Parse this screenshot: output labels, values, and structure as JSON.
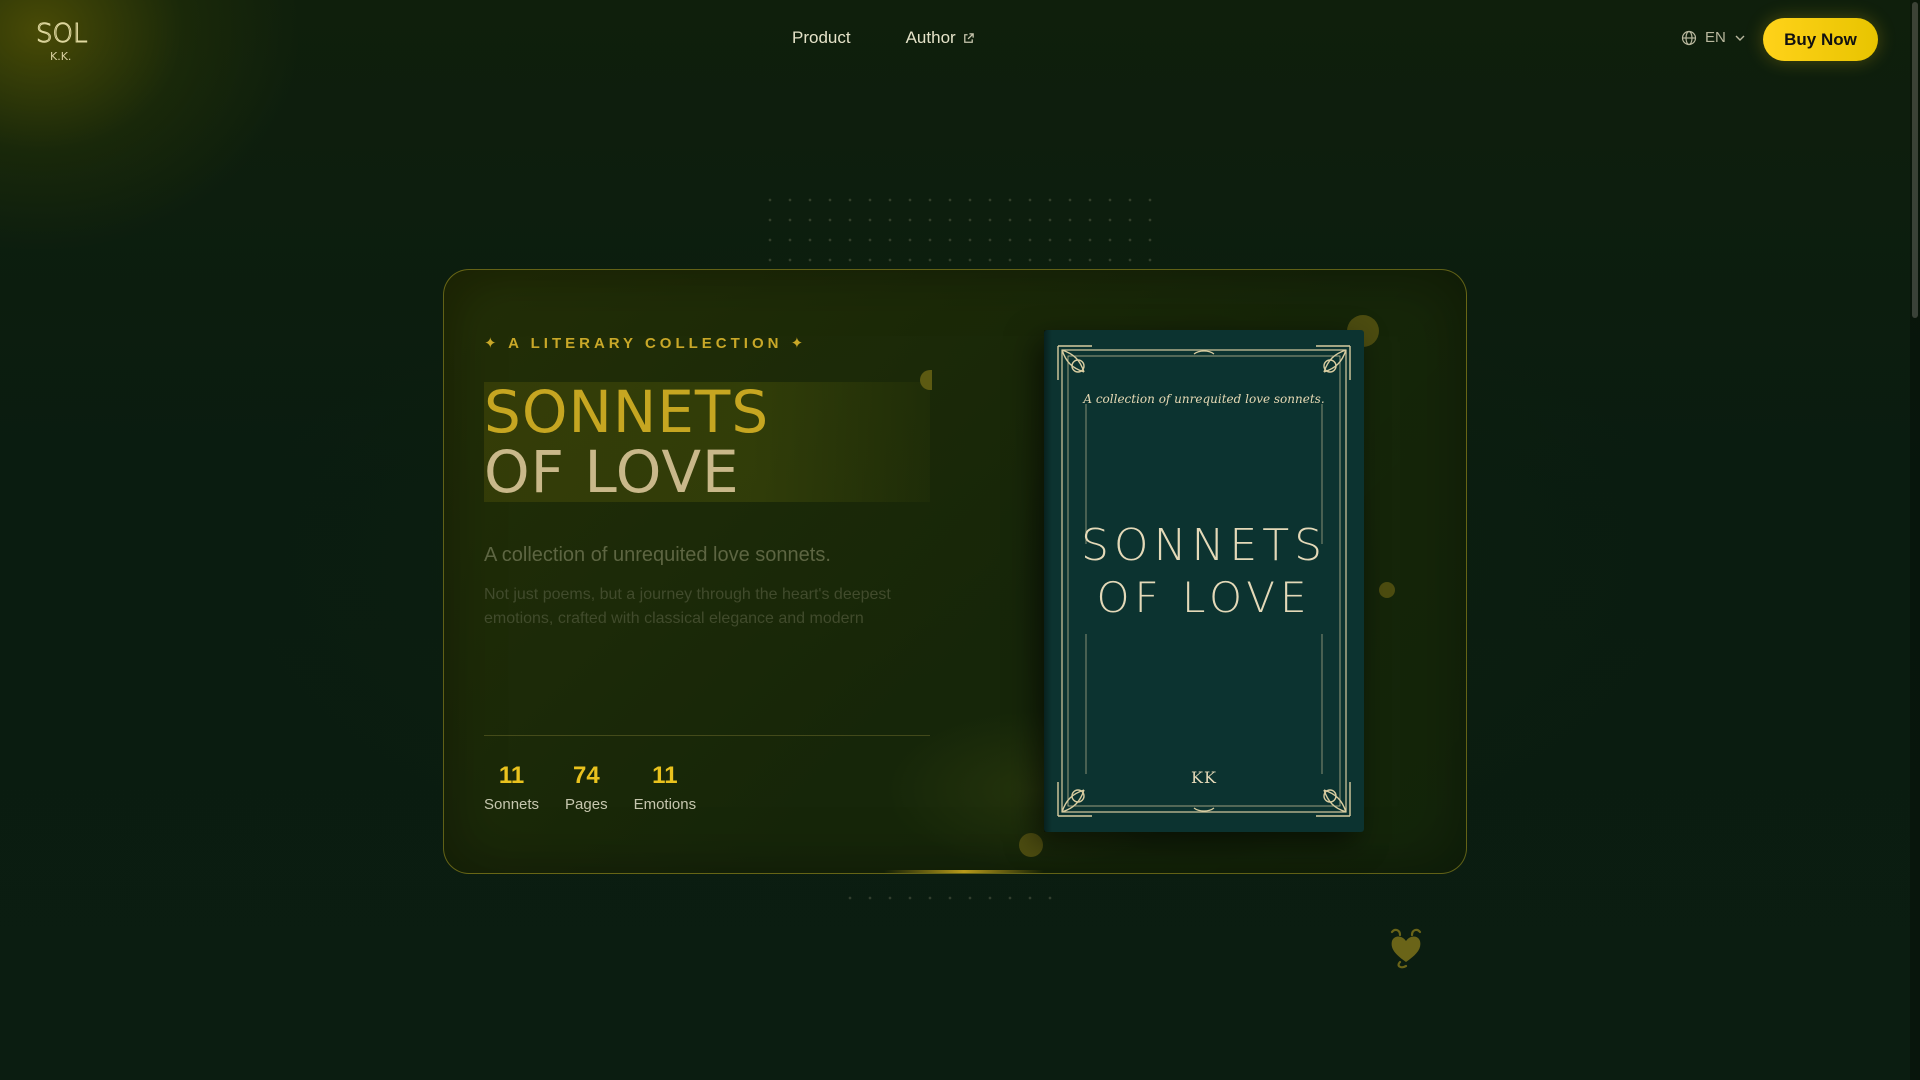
{
  "header": {
    "logo": {
      "main": "SOL",
      "sub": "K.K."
    },
    "nav": [
      {
        "label": "Product"
      },
      {
        "label": "Author",
        "icon": "external-link-icon"
      }
    ],
    "language": {
      "value": "EN",
      "icon": "globe-icon"
    },
    "buy_button": "Buy Now"
  },
  "hero": {
    "eyebrow": "✦ A LITERARY COLLECTION ✦",
    "title_line1": "SONNETS",
    "title_line2": "OF LOVE",
    "subtitle": "A collection of unrequited love sonnets.",
    "description": "Not just poems, but a journey through the heart's deepest emotions, crafted with classical elegance and modern",
    "stats": [
      {
        "value": "11",
        "label": "Sonnets"
      },
      {
        "value": "74",
        "label": "Pages"
      },
      {
        "value": "11",
        "label": "Emotions"
      }
    ]
  },
  "book": {
    "tagline": "A collection of unrequited love sonnets.",
    "title_line1": "SONNETS",
    "title_line2": "OF LOVE",
    "author": "KK"
  },
  "colors": {
    "accent": "#ffd21a",
    "title_gold": "#c6a621",
    "book_green": "#0c3330",
    "background": "#0b1d11"
  }
}
